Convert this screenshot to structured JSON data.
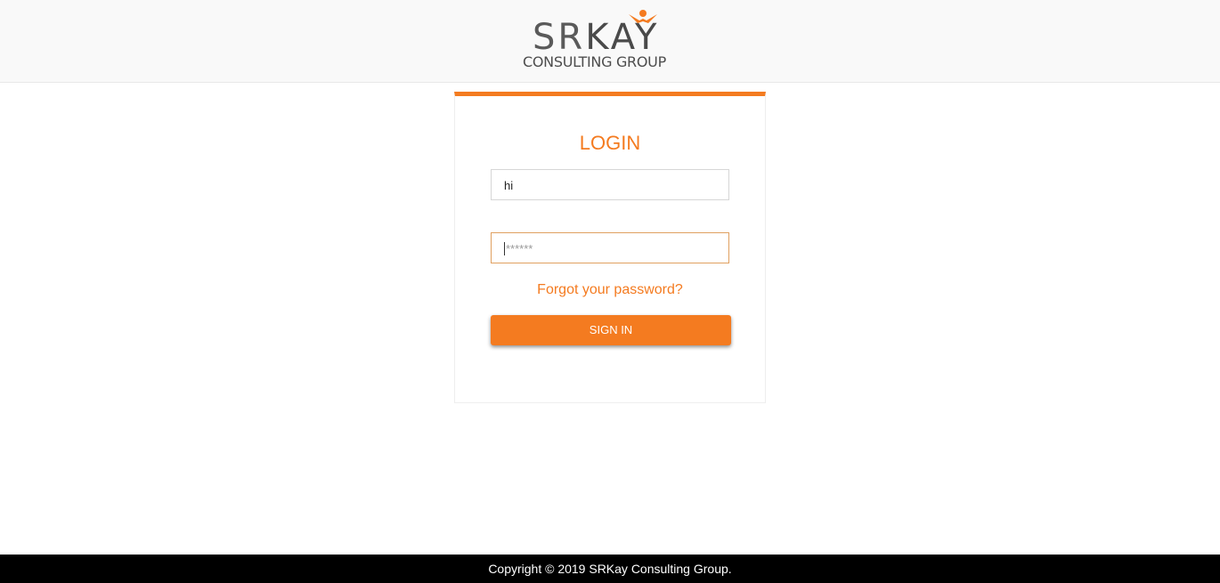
{
  "logo": {
    "main_text_sr": "SR",
    "main_text_kay": "KAY",
    "sub_text": "CONSULTING GROUP",
    "icon": "person-icon",
    "brand_color": "#f47b20"
  },
  "login": {
    "title": "LOGIN",
    "username_value": "hi",
    "password_value": "******",
    "forgot_label": "Forgot your password?",
    "signin_label": "SIGN IN"
  },
  "footer": {
    "copyright": "Copyright © 2019 SRKay Consulting Group."
  },
  "colors": {
    "accent": "#f47b20",
    "footer_bg": "#000000",
    "header_bg": "#f9f9f9"
  }
}
